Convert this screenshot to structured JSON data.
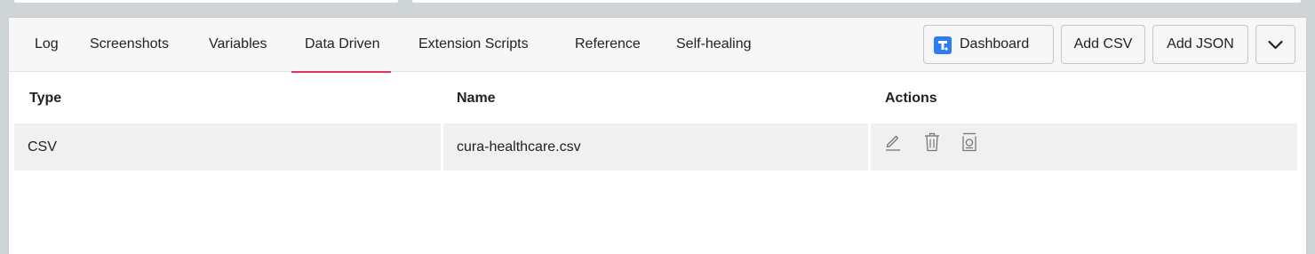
{
  "tabs": [
    {
      "label": "Log",
      "active": false
    },
    {
      "label": "Screenshots",
      "active": false
    },
    {
      "label": "Variables",
      "active": false
    },
    {
      "label": "Data Driven",
      "active": true
    },
    {
      "label": "Extension Scripts",
      "active": false
    },
    {
      "label": "Reference",
      "active": false
    },
    {
      "label": "Self-healing",
      "active": false
    }
  ],
  "toolbar": {
    "dashboard_label": "Dashboard",
    "add_csv_label": "Add CSV",
    "add_json_label": "Add JSON",
    "more_icon": "chevron-down-icon",
    "dashboard_icon": "brand-logo-icon"
  },
  "table": {
    "headers": {
      "type": "Type",
      "name": "Name",
      "actions": "Actions"
    },
    "rows": [
      {
        "type": "CSV",
        "name": "cura-healthcare.csv",
        "actions": [
          "edit-icon",
          "delete-icon",
          "preview-icon"
        ]
      }
    ]
  },
  "colors": {
    "accent": "#e0345e",
    "brand": "#2d7ef3"
  }
}
